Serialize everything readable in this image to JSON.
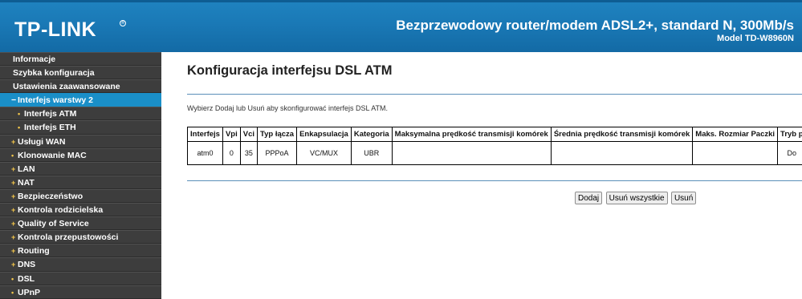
{
  "header": {
    "logo": "TP-LINK",
    "logo_mark": "®",
    "product": "Bezprzewodowy router/modem ADSL2+, standard N, 300Mb/s",
    "model": "Model TD-W8960N"
  },
  "sidebar": {
    "items": [
      {
        "label": "Informacje",
        "level": 0
      },
      {
        "label": "Szybka konfiguracja",
        "level": 0
      },
      {
        "label": "Ustawienia zaawansowane",
        "level": 0
      },
      {
        "label": "Interfejs warstwy 2",
        "level": 1,
        "active": true,
        "marker": "−"
      },
      {
        "label": "Interfejs ATM",
        "level": 2,
        "marker": "•"
      },
      {
        "label": "Interfejs ETH",
        "level": 2,
        "marker": "•"
      },
      {
        "label": "Usługi WAN",
        "level": 1,
        "marker": "+"
      },
      {
        "label": "Klonowanie MAC",
        "level": 1,
        "marker": "•"
      },
      {
        "label": "LAN",
        "level": 1,
        "marker": "+"
      },
      {
        "label": "NAT",
        "level": 1,
        "marker": "+"
      },
      {
        "label": "Bezpieczeństwo",
        "level": 1,
        "marker": "+"
      },
      {
        "label": "Kontrola rodzicielska",
        "level": 1,
        "marker": "+"
      },
      {
        "label": "Quality of Service",
        "level": 1,
        "marker": "+"
      },
      {
        "label": "Kontrola przepustowości",
        "level": 1,
        "marker": "+"
      },
      {
        "label": "Routing",
        "level": 1,
        "marker": "+"
      },
      {
        "label": "DNS",
        "level": 1,
        "marker": "+"
      },
      {
        "label": "DSL",
        "level": 1,
        "marker": "•"
      },
      {
        "label": "UPnP",
        "level": 1,
        "marker": "•"
      }
    ]
  },
  "main": {
    "title": "Konfiguracja interfejsu DSL ATM",
    "description": "Wybierz Dodaj lub Usuń aby skonfigurować interfejs DSL ATM.",
    "table": {
      "headers": [
        "Interfejs",
        "Vpi",
        "Vci",
        "Typ łącza",
        "Enkapsulacja",
        "Kategoria",
        "Maksymalna prędkość transmisji komórek",
        "Średnia prędkość transmisji komórek",
        "Maks. Rozmiar Paczki",
        "Tryb p"
      ],
      "rows": [
        [
          "atm0",
          "0",
          "35",
          "PPPoA",
          "VC/MUX",
          "UBR",
          "",
          "",
          "",
          "Do"
        ]
      ]
    },
    "buttons": {
      "add": "Dodaj",
      "remove_all": "Usuń wszystkie",
      "remove": "Usuń"
    }
  },
  "colors": {
    "header_blue": "#1a79b6",
    "sidebar_bg": "#3d3d3d",
    "active_item": "#1a8fc8",
    "bullet_yellow": "#f6c84b"
  }
}
